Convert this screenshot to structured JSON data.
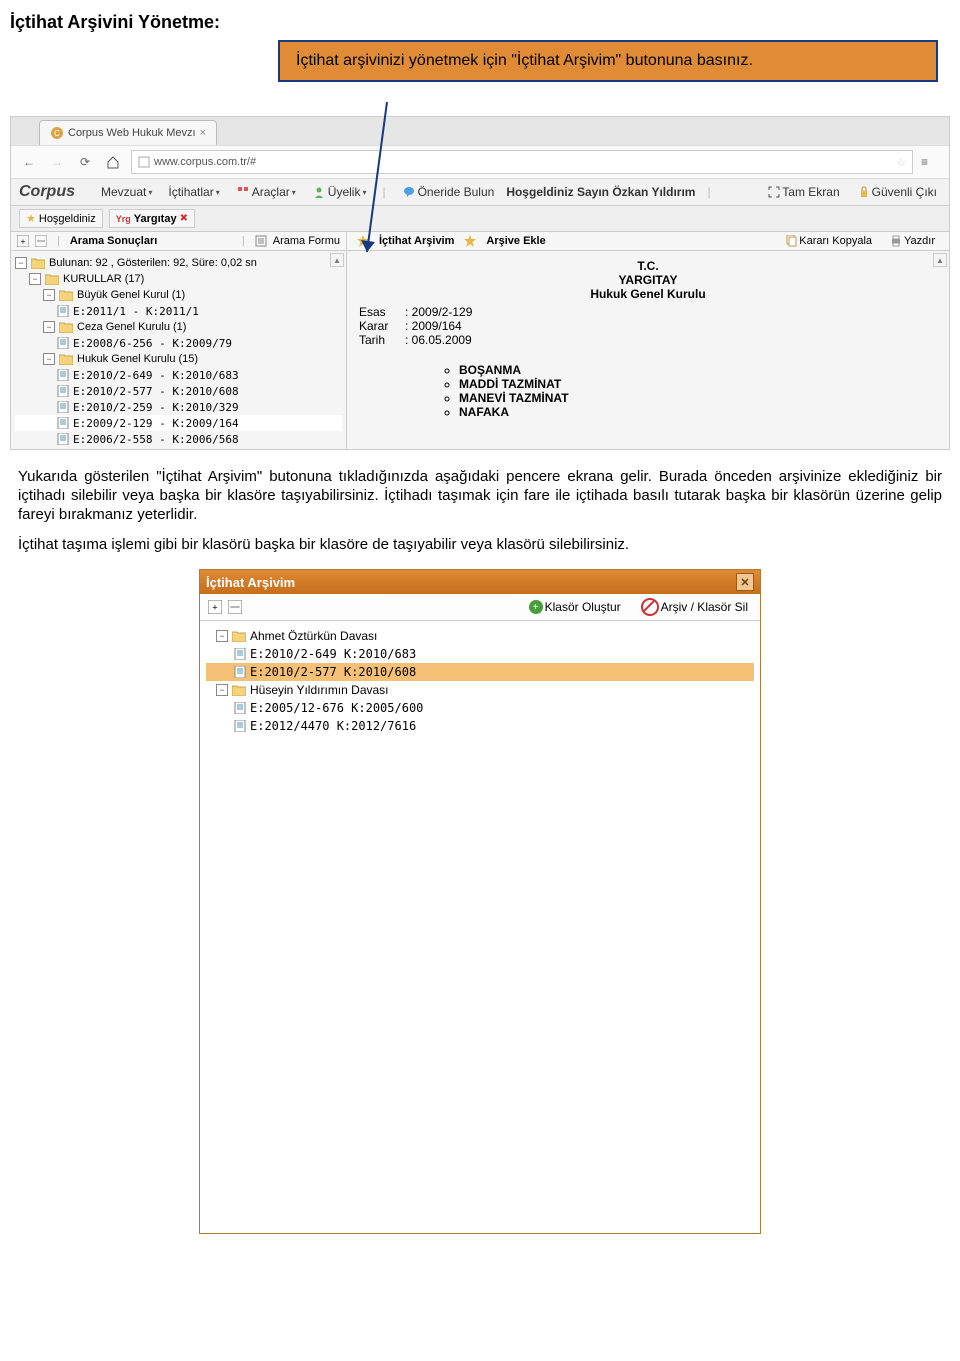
{
  "heading": "İçtihat Arşivini Yönetme:",
  "callout": "İçtihat arşivinizi yönetmek için \"İçtihat Arşivim\" butonuna basınız.",
  "browser": {
    "tab_title": "Corpus Web Hukuk Mevzı",
    "url_lock_label": "www.corpus.com.tr/#",
    "url_prefix": "□"
  },
  "app": {
    "logo": "Corpus",
    "menus": [
      "Mevzuat",
      "İçtihatlar",
      "Araçlar",
      "Üyelik"
    ],
    "suggest": "Öneride Bulun",
    "welcome": "Hoşgeldiniz Sayın Özkan Yıldırım",
    "fullscreen": "Tam Ekran",
    "logout": "Güvenli Çıkı"
  },
  "subtabs": {
    "t1": "Hoşgeldiniz",
    "t2": "Yargıtay"
  },
  "left": {
    "h1": "Arama Sonuçları",
    "h2": "Arama Formu",
    "stat": "Bulunan: 92 , Gösterilen: 92, Süre: 0,02 sn",
    "k_label": "KURULLAR (17)",
    "bgk": "Büyük Genel Kurul (1)",
    "bgk_item": "E:2011/1       -  K:2011/1",
    "cgk": "Ceza Genel Kurulu (1)",
    "cgk_item": "E:2008/6-256 - K:2009/79",
    "hgk": "Hukuk Genel Kurulu (15)",
    "hgk_items": [
      "E:2010/2-649 - K:2010/683",
      "E:2010/2-577 - K:2010/608",
      "E:2010/2-259 - K:2010/329",
      "E:2009/2-129 - K:2009/164",
      "E:2006/2-558 - K:2006/568"
    ]
  },
  "right": {
    "btn1": "İçtihat Arşivim",
    "btn2": "Arşive Ekle",
    "copy": "Kararı Kopyala",
    "print": "Yazdır",
    "court1": "T.C.",
    "court2": "YARGITAY",
    "court3": "Hukuk Genel Kurulu",
    "esas_l": "Esas",
    "esas_v": ": 2009/2-129",
    "karar_l": "Karar",
    "karar_v": ": 2009/164",
    "tarih_l": "Tarih",
    "tarih_v": ": 06.05.2009",
    "topics": [
      "BOŞANMA",
      "MADDİ TAZMİNAT",
      "MANEVİ TAZMİNAT",
      "NAFAKA"
    ]
  },
  "para1": "Yukarıda gösterilen \"İçtihat Arşivim\" butonuna tıkladığınızda aşağıdaki pencere ekrana gelir. Burada önceden arşivinize eklediğiniz bir içtihadı silebilir veya başka bir klasöre taşıyabilirsiniz. İçtihadı taşımak için fare ile içtihada basılı tutarak başka bir klasörün üzerine gelip fareyi bırakmanız yeterlidir.",
  "para2": "İçtihat taşıma işlemi gibi bir klasörü başka bir klasöre de taşıyabilir veya klasörü silebilirsiniz.",
  "modal": {
    "title": "İçtihat Arşivim",
    "new_folder": "Klasör Oluştur",
    "delete": "Arşiv / Klasör Sil",
    "folder1": "Ahmet Öztürkün Davası",
    "f1_items": [
      "E:2010/2-649 K:2010/683",
      "E:2010/2-577 K:2010/608"
    ],
    "folder2": "Hüseyin Yıldırımın Davası",
    "f2_items": [
      "E:2005/12-676 K:2005/600",
      "E:2012/4470 K:2012/7616"
    ]
  }
}
